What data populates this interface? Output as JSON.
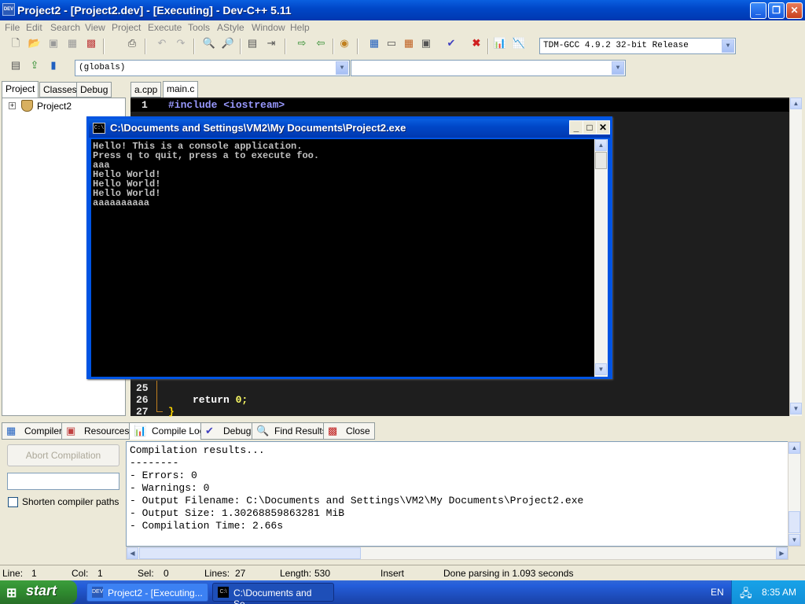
{
  "window": {
    "title": "Project2 - [Project2.dev] - [Executing] - Dev-C++ 5.11",
    "icon_label": "DEV",
    "controls": {
      "minimize": "_",
      "maximize": "❐",
      "close": "✕"
    }
  },
  "menu": [
    "File",
    "Edit",
    "Search",
    "View",
    "Project",
    "Execute",
    "Tools",
    "AStyle",
    "Window",
    "Help"
  ],
  "toolbar": {
    "compiler_select": "TDM-GCC 4.9.2 32-bit Release",
    "scope_select": "(globals)",
    "function_select": ""
  },
  "left_panel": {
    "tabs": [
      "Project",
      "Classes",
      "Debug"
    ],
    "active_tab": "Project",
    "tree_root": "Project2",
    "expander": "+"
  },
  "editor": {
    "tabs": [
      "a.cpp",
      "main.c"
    ],
    "active_tab": "main.c",
    "visible_lines": [
      {
        "num": "1",
        "code": "#include <iostream>"
      },
      {
        "num": "25",
        "code": ""
      },
      {
        "num": "26",
        "code": "return 0;"
      },
      {
        "num": "27",
        "code": "}"
      }
    ]
  },
  "console": {
    "title": "C:\\Documents and Settings\\VM2\\My Documents\\Project2.exe",
    "icon_label": "C:\\",
    "controls": {
      "minimize": "_",
      "maximize": "□",
      "close": "✕"
    },
    "lines": [
      "Hello! This is a console application.",
      "Press q to quit, press a to execute foo.",
      "aaa",
      "Hello World!",
      "Hello World!",
      "Hello World!",
      "aaaaaaaaaa"
    ]
  },
  "bottom_panel": {
    "tabs": [
      "Compiler",
      "Resources",
      "Compile Log",
      "Debug",
      "Find Results",
      "Close"
    ],
    "active_tab": "Compile Log",
    "abort_button": "Abort Compilation",
    "shorten_paths_label": "Shorten compiler paths",
    "log_lines": [
      "Compilation results...",
      "--------",
      "- Errors: 0",
      "- Warnings: 0",
      "- Output Filename: C:\\Documents and Settings\\VM2\\My Documents\\Project2.exe",
      "- Output Size: 1.30268859863281 MiB",
      "- Compilation Time: 2.66s"
    ]
  },
  "status": {
    "line_label": "Line:",
    "line_value": "1",
    "col_label": "Col:",
    "col_value": "1",
    "sel_label": "Sel:",
    "sel_value": "0",
    "lines_label": "Lines:",
    "lines_value": "27",
    "length_label": "Length:",
    "length_value": "530",
    "mode": "Insert",
    "message": "Done parsing in 1.093 seconds"
  },
  "taskbar": {
    "start_label": "start",
    "items": [
      "Project2 - [Executing...",
      "C:\\Documents and Se..."
    ],
    "language": "EN",
    "clock": "8:35 AM"
  },
  "colors": {
    "xp_blue": "#0047c8",
    "editor_bg": "#1e1e1e",
    "keyword": "#9999ff",
    "number": "#ffff66"
  }
}
